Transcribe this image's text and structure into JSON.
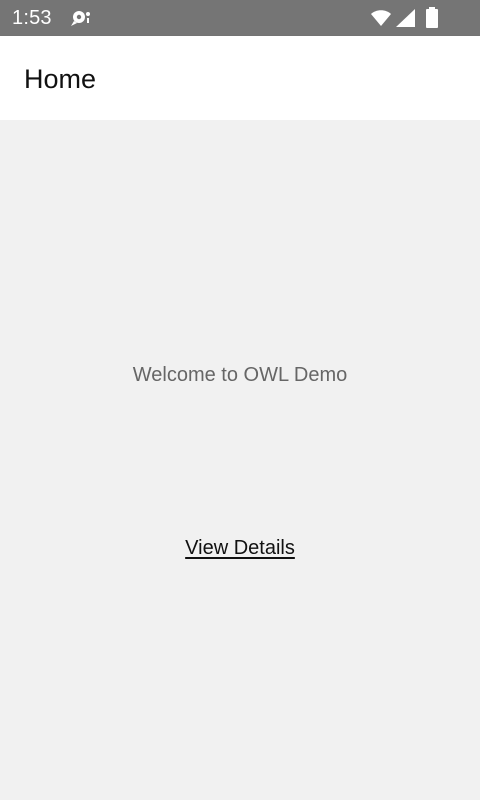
{
  "status_bar": {
    "time": "1:53",
    "icons": [
      "notification-icon",
      "wifi-icon",
      "signal-icon",
      "battery-icon"
    ]
  },
  "app_bar": {
    "title": "Home"
  },
  "main": {
    "welcome_text": "Welcome to OWL Demo",
    "details_link": "View Details"
  },
  "colors": {
    "status_bar": "#757575",
    "background": "#f1f1f1",
    "app_bar": "#ffffff",
    "muted_text": "#666666",
    "primary_text": "#111111"
  }
}
